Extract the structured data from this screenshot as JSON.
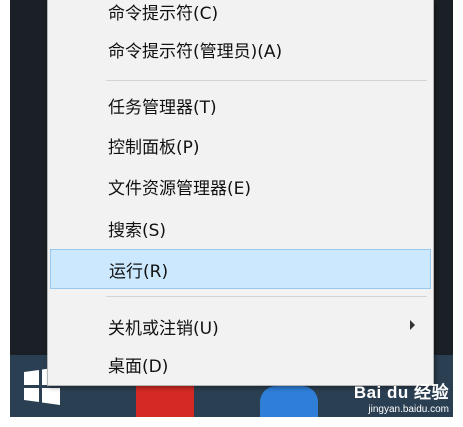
{
  "menu": {
    "items": [
      {
        "label": "命令提示符(C)"
      },
      {
        "label": "命令提示符(管理员)(A)"
      },
      {
        "label": "任务管理器(T)"
      },
      {
        "label": "控制面板(P)"
      },
      {
        "label": "文件资源管理器(E)"
      },
      {
        "label": "搜索(S)"
      },
      {
        "label": "运行(R)",
        "highlighted": true
      },
      {
        "label": "关机或注销(U)",
        "has_submenu": true
      },
      {
        "label": "桌面(D)"
      }
    ]
  },
  "taskbar": {
    "start_icon": "windows-logo-icon",
    "app_icons": [
      "red-app-icon",
      "blue-app-icon"
    ]
  },
  "watermark": {
    "logo_text": "Bai du 经验",
    "url": "jingyan.baidu.com"
  },
  "colors": {
    "menu_bg": "#f2f2f2",
    "highlight_bg": "#cce8ff",
    "highlight_border": "#99c9ef",
    "taskbar_dark": "#1a2026",
    "taskbar_blue": "#2b3f52"
  }
}
